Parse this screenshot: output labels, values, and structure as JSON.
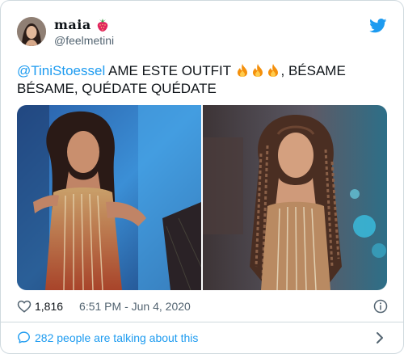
{
  "user": {
    "display_name": "maia",
    "handle": "@feelmetini",
    "badge_icon": "strawberry-icon"
  },
  "tweet": {
    "mention": "@TiniStoessel",
    "text_part1": " AME ESTE OUTFIT ",
    "fire_icons": [
      "fire-icon",
      "fire-icon",
      "fire-icon"
    ],
    "text_part2": ", BÉSAME BÉSAME, QUÉDATE QUÉDATE"
  },
  "stats": {
    "likes": "1,816",
    "timestamp": "6:51 PM - Jun 4, 2020"
  },
  "footer": {
    "talking_label": "282 people are talking about this"
  },
  "colors": {
    "accent": "#1d9bf0",
    "secondary_text": "#536471",
    "border": "#cfd9de"
  }
}
